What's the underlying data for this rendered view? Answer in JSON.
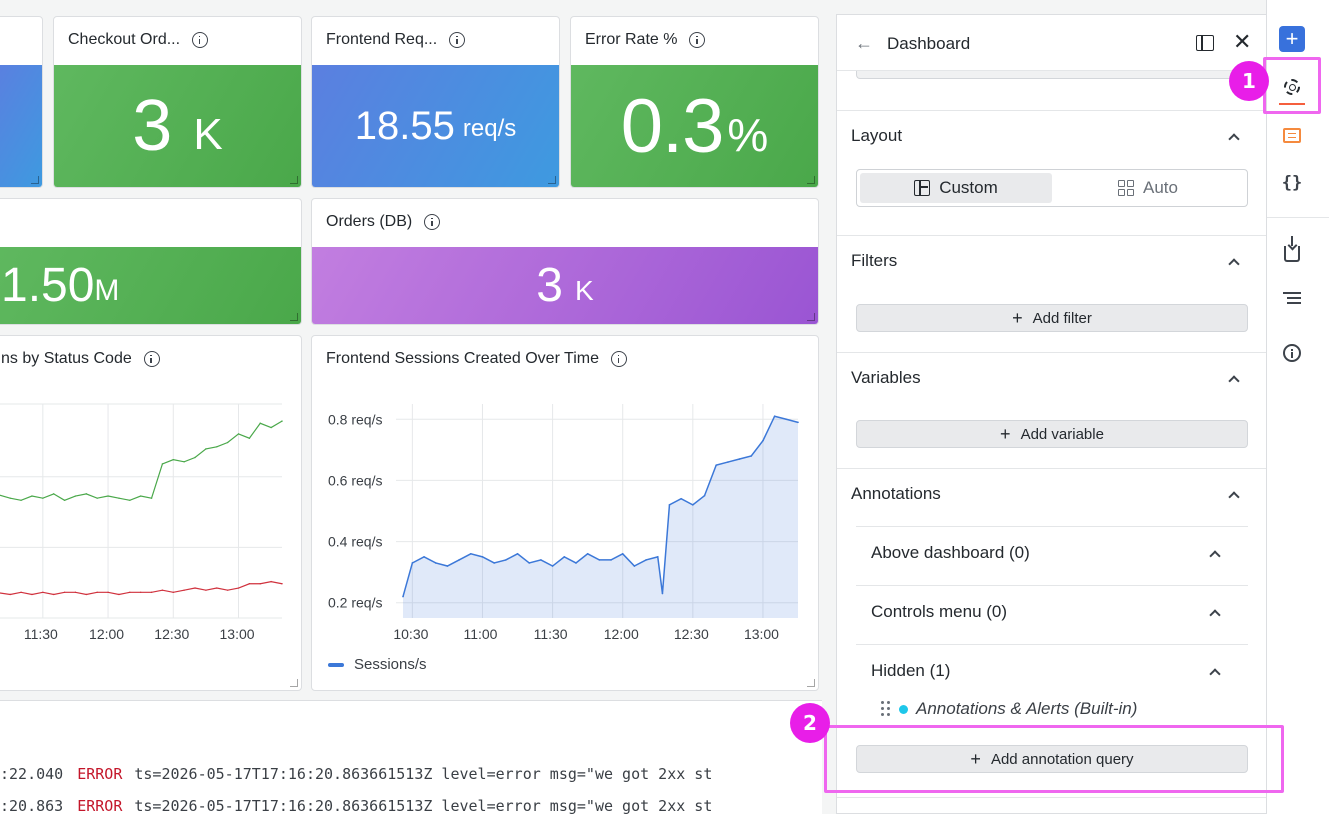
{
  "panels": {
    "checkout": {
      "title": "Checkout Ord...",
      "value": "3",
      "unit": "K",
      "color": "#4aa84a"
    },
    "frontend": {
      "title": "Frontend Req...",
      "value": "18.55",
      "unit": "req/s",
      "color": "#3e9ae0"
    },
    "error_rate": {
      "title": "Error Rate %",
      "value": "0.3",
      "unit": "%",
      "color": "#4aa84a"
    },
    "partial_stat": {
      "value": "1.50",
      "unit": "M",
      "color": "#4aa84a"
    },
    "orders": {
      "title": "Orders (DB)",
      "value": "3",
      "unit": "K",
      "color": "#9a55d3"
    },
    "status_chart": {
      "title": "ns by Status Code",
      "x_ticks": [
        "11:30",
        "12:00",
        "12:30",
        "13:00"
      ]
    },
    "sessions_chart": {
      "title": "Frontend Sessions Created Over Time",
      "legend": "Sessions/s"
    }
  },
  "chart_data": [
    {
      "type": "line",
      "title": "Frontend Sessions Created Over Time",
      "xlabel": "",
      "ylabel": "",
      "x_ticks": [
        "10:30",
        "11:00",
        "11:30",
        "12:00",
        "12:30",
        "13:00"
      ],
      "y_ticks": [
        "0.2 req/s",
        "0.4 req/s",
        "0.6 req/s",
        "0.8 req/s"
      ],
      "ylim": [
        0.15,
        0.85
      ],
      "x": [
        "10:26",
        "10:30",
        "10:35",
        "10:40",
        "10:45",
        "10:50",
        "10:55",
        "11:00",
        "11:05",
        "11:10",
        "11:15",
        "11:20",
        "11:25",
        "11:30",
        "11:35",
        "11:40",
        "11:45",
        "11:50",
        "11:55",
        "12:00",
        "12:05",
        "12:10",
        "12:15",
        "12:17",
        "12:20",
        "12:25",
        "12:30",
        "12:35",
        "12:40",
        "12:45",
        "12:50",
        "12:55",
        "13:00",
        "13:05",
        "13:10",
        "13:15"
      ],
      "series": [
        {
          "name": "Sessions/s",
          "color": "#3c78d8",
          "values": [
            0.22,
            0.33,
            0.35,
            0.33,
            0.32,
            0.34,
            0.36,
            0.35,
            0.33,
            0.34,
            0.36,
            0.33,
            0.34,
            0.32,
            0.35,
            0.33,
            0.36,
            0.34,
            0.34,
            0.36,
            0.32,
            0.34,
            0.35,
            0.23,
            0.52,
            0.54,
            0.52,
            0.55,
            0.65,
            0.66,
            0.67,
            0.68,
            0.73,
            0.81,
            0.8,
            0.79
          ]
        }
      ],
      "grid": true,
      "legend": "bottom-left"
    },
    {
      "type": "line",
      "title": "ns by Status Code",
      "x_ticks": [
        "11:30",
        "12:00",
        "12:30",
        "13:00"
      ],
      "x": [
        "11:08",
        "11:15",
        "11:20",
        "11:25",
        "11:30",
        "11:35",
        "11:40",
        "11:45",
        "11:50",
        "11:55",
        "12:00",
        "12:05",
        "12:10",
        "12:15",
        "12:20",
        "12:25",
        "12:30",
        "12:35",
        "12:40",
        "12:45",
        "12:50",
        "12:55",
        "13:00",
        "13:05",
        "13:10",
        "13:15",
        "13:20"
      ],
      "series": [
        {
          "color": "#4aa84a",
          "values": [
            0.58,
            0.56,
            0.55,
            0.57,
            0.56,
            0.58,
            0.55,
            0.57,
            0.58,
            0.56,
            0.57,
            0.56,
            0.55,
            0.57,
            0.56,
            0.72,
            0.74,
            0.73,
            0.75,
            0.79,
            0.8,
            0.82,
            0.86,
            0.84,
            0.91,
            0.89,
            0.92
          ]
        },
        {
          "color": "#d0313d",
          "values": [
            0.12,
            0.11,
            0.12,
            0.11,
            0.12,
            0.11,
            0.12,
            0.12,
            0.11,
            0.12,
            0.12,
            0.11,
            0.12,
            0.12,
            0.12,
            0.13,
            0.12,
            0.13,
            0.14,
            0.13,
            0.14,
            0.13,
            0.14,
            0.16,
            0.16,
            0.17,
            0.16
          ]
        }
      ],
      "grid": true
    }
  ],
  "logs": [
    {
      "time": ":22.040",
      "level": "ERROR",
      "msg": "ts=2026-05-17T17:16:20.863661513Z level=error msg=\"we got 2xx st"
    },
    {
      "time": ":20.863",
      "level": "ERROR",
      "msg": "ts=2026-05-17T17:16:20.863661513Z level=error msg=\"we got 2xx st"
    }
  ],
  "sidebar": {
    "title": "Dashboard",
    "layout": {
      "title": "Layout",
      "options": [
        "Custom",
        "Auto"
      ],
      "selected": "Custom"
    },
    "filters": {
      "title": "Filters",
      "add_label": "Add filter"
    },
    "variables": {
      "title": "Variables",
      "add_label": "Add variable"
    },
    "annotations": {
      "title": "Annotations",
      "groups": [
        {
          "label": "Above dashboard (0)"
        },
        {
          "label": "Controls menu (0)"
        },
        {
          "label": "Hidden (1)"
        }
      ],
      "hidden_item": "Annotations & Alerts (Built-in)",
      "add_label": "Add annotation query"
    }
  },
  "toolbar": {
    "items": [
      "add-icon",
      "gear-icon",
      "comment-icon",
      "json-icon",
      "download-icon",
      "outline-icon",
      "info-icon"
    ],
    "json_glyph": "{}"
  },
  "callouts": [
    {
      "number": "1"
    },
    {
      "number": "2"
    }
  ]
}
